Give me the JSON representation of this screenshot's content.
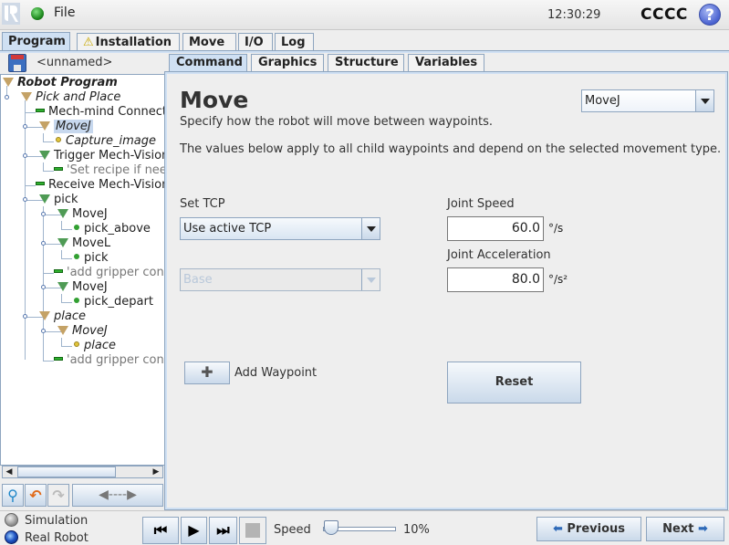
{
  "header": {
    "menu_file": "File",
    "clock": "12:30:29",
    "robot_name": "CCCC",
    "help_glyph": "?"
  },
  "main_tabs": [
    {
      "label": "Program",
      "active": true
    },
    {
      "label": "Installation",
      "warning": true
    },
    {
      "label": "Move"
    },
    {
      "label": "I/O"
    },
    {
      "label": "Log"
    }
  ],
  "warning_glyph": "⚠",
  "program": {
    "name": "<unnamed>"
  },
  "tree": [
    {
      "label": "Robot Program",
      "icon": "folder-triangle",
      "style": "bold-italic"
    },
    {
      "label": "Pick and Place",
      "icon": "folder-triangle",
      "style": "italic"
    },
    {
      "label": "Mech-mind Connect",
      "icon": "script-bar"
    },
    {
      "label": "MoveJ",
      "icon": "folder-triangle",
      "style": "italic",
      "selected": true
    },
    {
      "label": "Capture_image",
      "icon": "waypoint-yellow",
      "style": "italic"
    },
    {
      "label": "Trigger Mech-Vision",
      "icon": "folder-triangle-green"
    },
    {
      "label": "'Set recipe if nee",
      "icon": "script-bar",
      "style": "dim"
    },
    {
      "label": "Receive Mech-Vision",
      "icon": "script-bar"
    },
    {
      "label": "pick",
      "icon": "folder-triangle-green"
    },
    {
      "label": "MoveJ",
      "icon": "folder-triangle-green"
    },
    {
      "label": "pick_above",
      "icon": "waypoint-green"
    },
    {
      "label": "MoveL",
      "icon": "folder-triangle-green"
    },
    {
      "label": "pick",
      "icon": "waypoint-green"
    },
    {
      "label": "'add gripper cont",
      "icon": "script-bar",
      "style": "dim"
    },
    {
      "label": "MoveJ",
      "icon": "folder-triangle-green"
    },
    {
      "label": "pick_depart",
      "icon": "waypoint-green"
    },
    {
      "label": "place",
      "icon": "folder-triangle",
      "style": "italic"
    },
    {
      "label": "MoveJ",
      "icon": "folder-triangle",
      "style": "italic"
    },
    {
      "label": "place",
      "icon": "waypoint-yellow",
      "style": "italic"
    },
    {
      "label": "'add gripper cont",
      "icon": "script-bar",
      "style": "dim"
    }
  ],
  "tree_toolbar": {
    "search_glyph": "⚲",
    "undo_glyph": "↶",
    "redo_glyph": "↷",
    "move_glyph": "◀----▶"
  },
  "sub_tabs": [
    {
      "label": "Command",
      "active": true
    },
    {
      "label": "Graphics"
    },
    {
      "label": "Structure"
    },
    {
      "label": "Variables"
    }
  ],
  "command": {
    "title": "Move",
    "subtitle": "Specify how the robot will move between waypoints.",
    "description": "The values below apply to all child waypoints and depend on the selected movement type.",
    "move_type": "MoveJ",
    "tcp_label": "Set TCP",
    "tcp_value": "Use active TCP",
    "feature_value": "Base",
    "joint_speed_label": "Joint Speed",
    "joint_speed_value": "60.0",
    "joint_speed_unit": "°/s",
    "joint_accel_label": "Joint Acceleration",
    "joint_accel_value": "80.0",
    "joint_accel_unit": "°/s²",
    "add_waypoint_glyph": "✚",
    "add_waypoint_label": "Add Waypoint",
    "reset_label": "Reset"
  },
  "footer": {
    "simulation_label": "Simulation",
    "real_robot_label": "Real Robot",
    "mode_selected": "Real Robot",
    "rewind_glyph": "⏮",
    "play_glyph": "▶",
    "step_glyph": "⏭",
    "speed_label": "Speed",
    "speed_value_pct": 10,
    "speed_text": "10%",
    "previous_label": "Previous",
    "next_label": "Next",
    "prev_arrow": "⬅",
    "next_arrow": "➡"
  }
}
